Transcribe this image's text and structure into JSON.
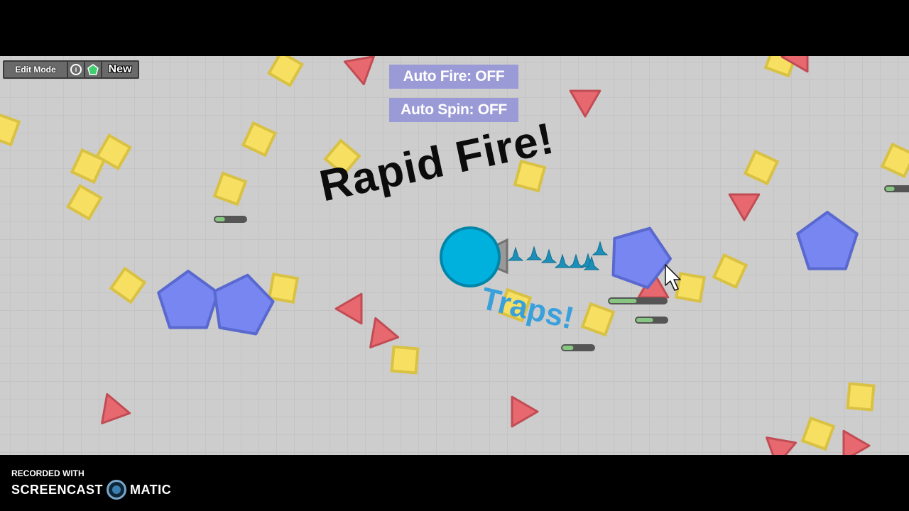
{
  "toolbar": {
    "edit_mode_label": "Edit Mode",
    "info_icon": "info-icon",
    "shape_icon": "pentagon-icon",
    "new_label": "New"
  },
  "toggles": {
    "auto_fire": "Auto Fire: OFF",
    "auto_spin": "Auto Spin: OFF"
  },
  "captions": {
    "rapid_fire": "Rapid Fire!",
    "traps": "Traps!"
  },
  "recording": {
    "recorded_with": "RECORDED WITH",
    "brand_left": "SCREENCAST",
    "brand_right": "MATIC"
  },
  "colors": {
    "arena_bg": "#cdcdcd",
    "square_fill": "#f7e061",
    "square_stroke": "#d9c144",
    "triangle_fill": "#e7696f",
    "triangle_stroke": "#c24c54",
    "pentagon_fill": "#7786f0",
    "pentagon_stroke": "#5a69cf",
    "player_fill": "#00b1de",
    "player_stroke": "#0085a8",
    "barrel_fill": "#999999",
    "trap_fill": "#1c8fb8",
    "toggle_bg": "#9a9ad6",
    "healthbar_track": "#555555",
    "healthbar_fill": "#86c680"
  }
}
